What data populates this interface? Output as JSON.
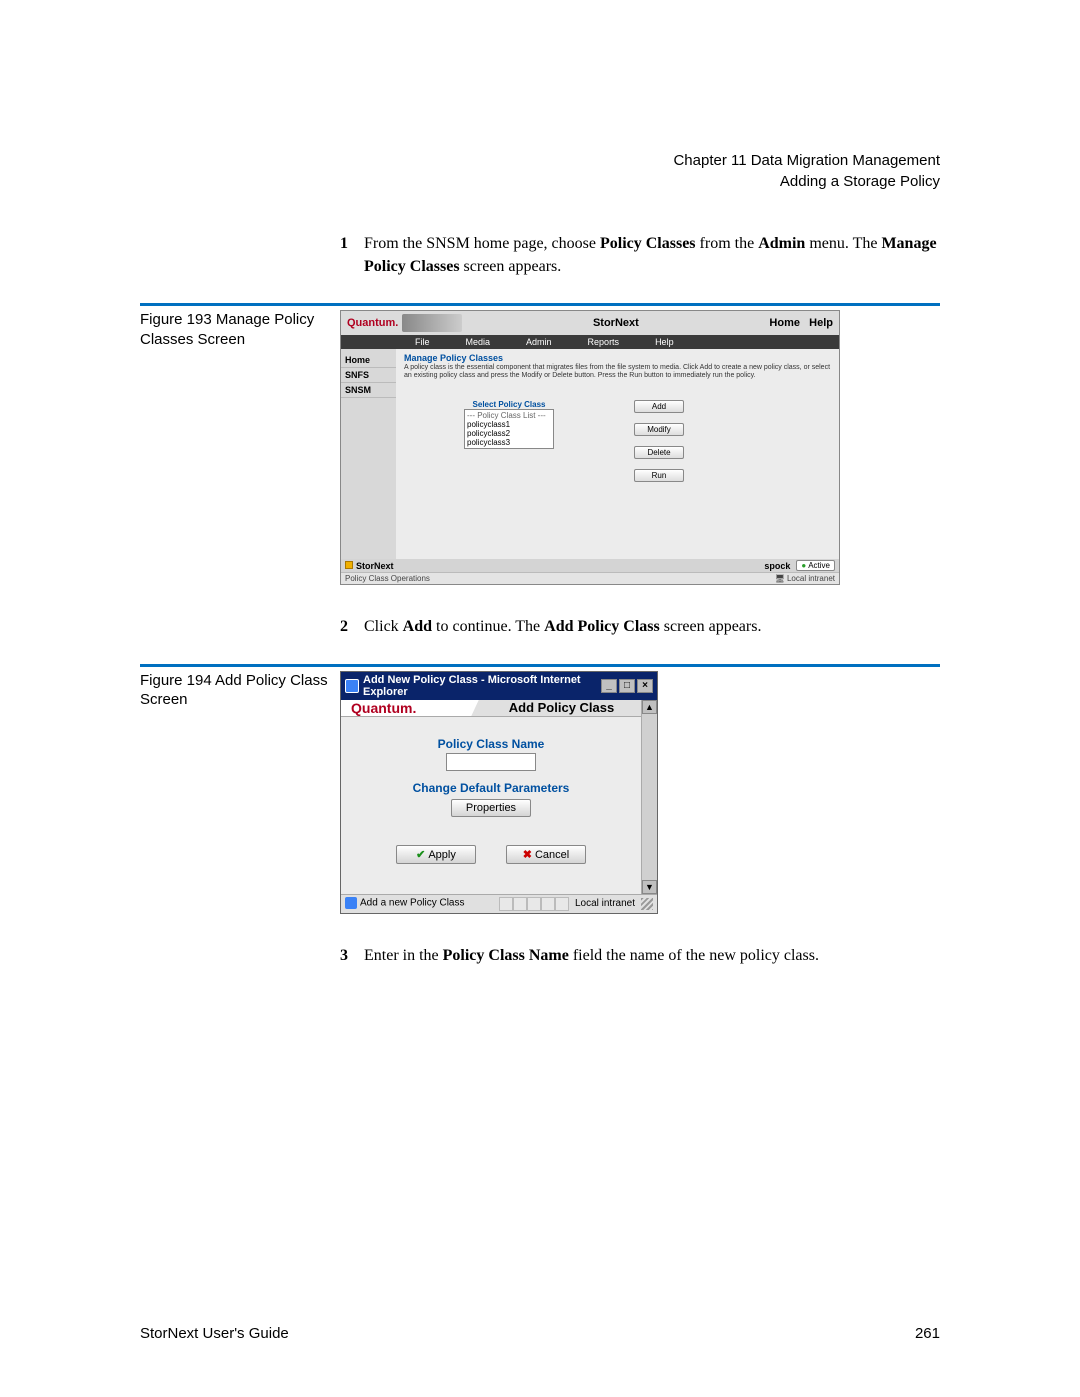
{
  "header": {
    "chapter": "Chapter 11  Data Migration Management",
    "section": "Adding a Storage Policy"
  },
  "steps": {
    "s1": {
      "num": "1",
      "pre": "From the SNSM home page, choose ",
      "b1": "Policy Classes",
      "mid1": " from the ",
      "b2": "Admin",
      "mid2": " menu. The ",
      "b3": "Manage Policy Classes",
      "post": " screen appears."
    },
    "s2": {
      "num": "2",
      "pre": "Click ",
      "b1": "Add",
      "mid1": " to continue. The ",
      "b2": "Add Policy Class",
      "post": " screen appears."
    },
    "s3": {
      "num": "3",
      "pre": "Enter in the ",
      "b1": "Policy Class Name",
      "post": " field the name of the new policy class."
    }
  },
  "fig193": {
    "caption": "Figure 193  Manage Policy Classes Screen",
    "logo": "Quantum",
    "title": "StorNext",
    "home": "Home",
    "help": "Help",
    "menus": {
      "file": "File",
      "media": "Media",
      "admin": "Admin",
      "reports": "Reports",
      "helpm": "Help"
    },
    "side": {
      "home": "Home",
      "snfs": "SNFS",
      "snsm": "SNSM"
    },
    "heading": "Manage Policy Classes",
    "desc": "A policy class is the essential component that migrates files from the file system to media. Click Add to create a new policy class, or select an existing policy class and press the Modify or Delete button. Press the Run button to immediately run the policy.",
    "list_label": "Select Policy Class",
    "list_header": "--- Policy Class List ---",
    "items": {
      "a": "policyclass1",
      "b": "policyclass2",
      "c": "policyclass3"
    },
    "btns": {
      "add": "Add",
      "modify": "Modify",
      "delete": "Delete",
      "run": "Run"
    },
    "status_left_icon_label": "StorNext",
    "status_host": "spock",
    "status_active": "Active",
    "ie_status_left": "Policy Class Operations",
    "ie_status_right": "Local intranet"
  },
  "fig194": {
    "caption": "Figure 194  Add Policy Class Screen",
    "win_title": "Add New Policy Class - Microsoft Internet Explorer",
    "logo": "Quantum.",
    "tab_title": "Add Policy Class",
    "label_name": "Policy Class Name",
    "label_change": "Change Default Parameters",
    "btn_props": "Properties",
    "btn_apply": "Apply",
    "btn_cancel": "Cancel",
    "status_left": "Add a new Policy Class",
    "status_right": "Local intranet"
  },
  "footer": {
    "left": "StorNext User's Guide",
    "right": "261"
  }
}
